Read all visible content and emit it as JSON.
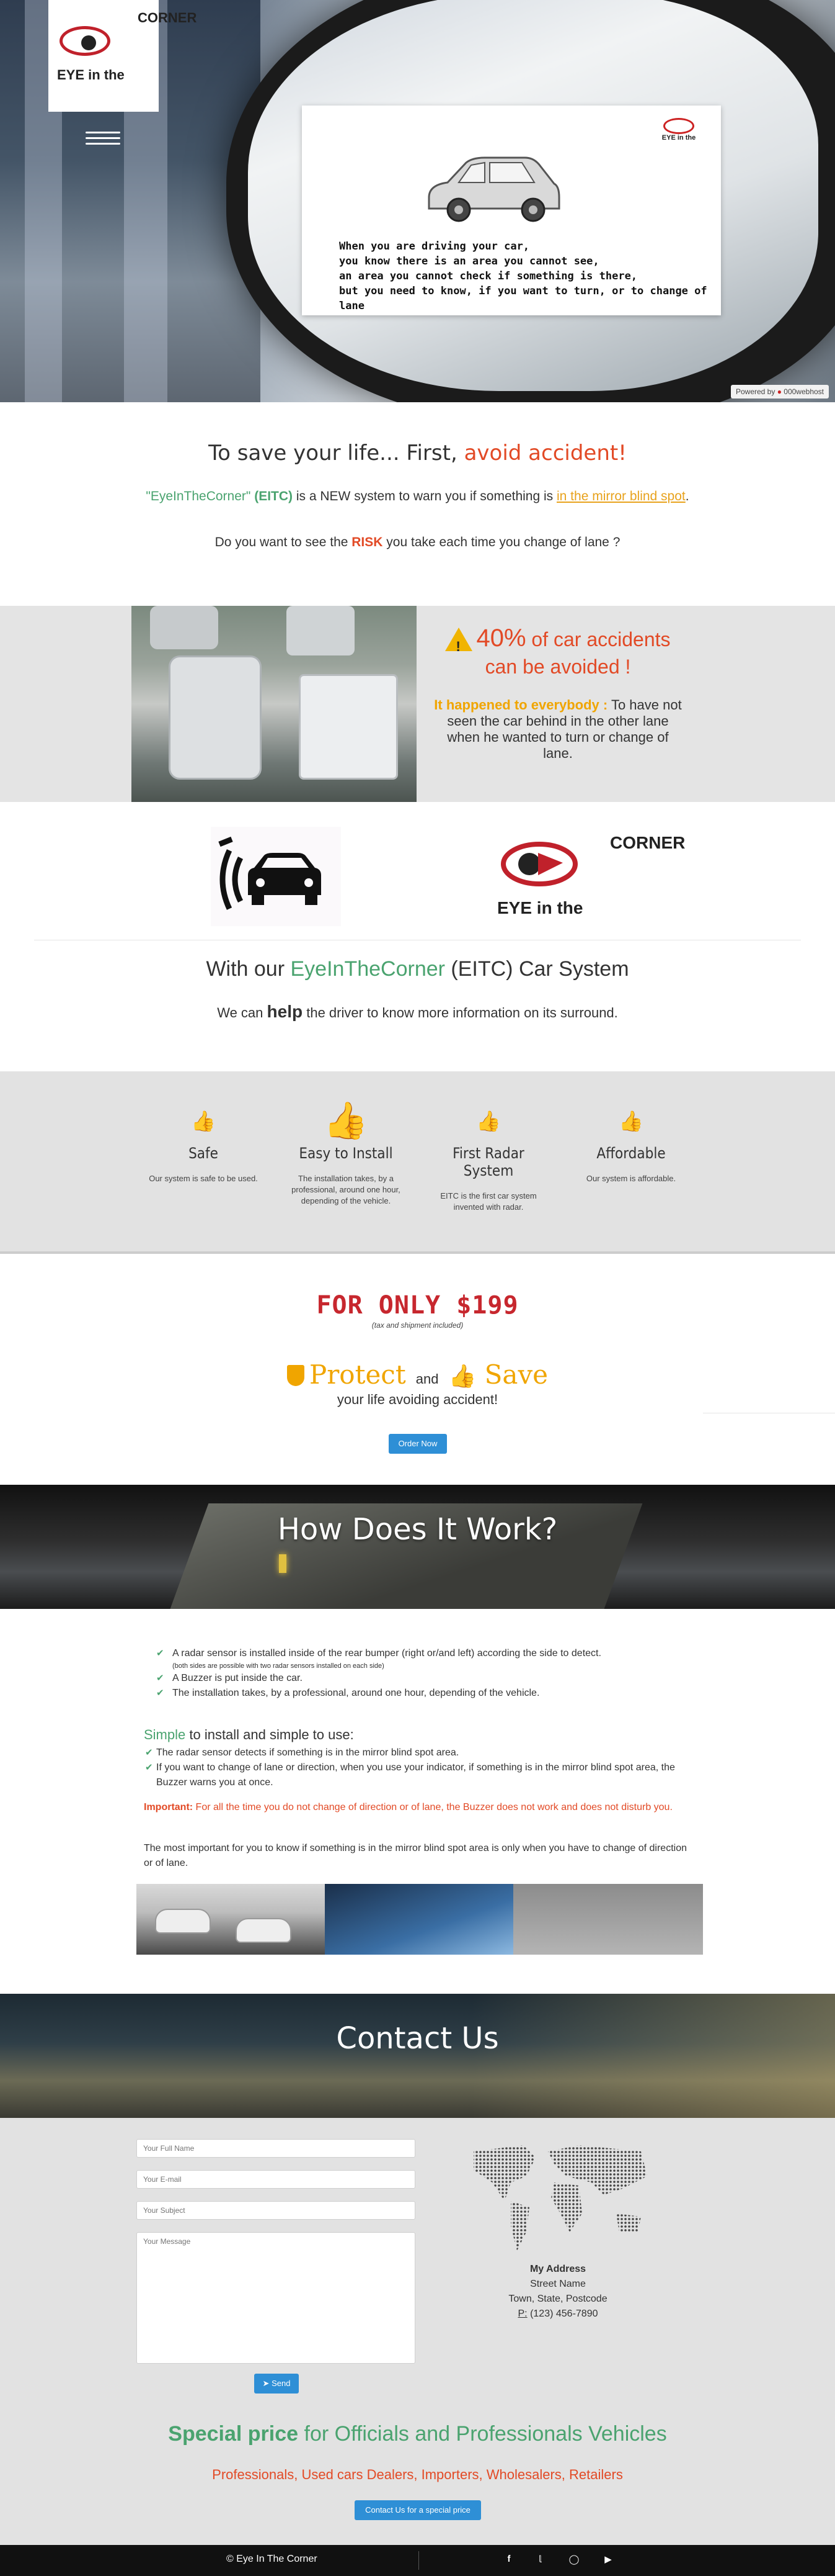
{
  "hero": {
    "logo": {
      "eye_text": "EYE in the",
      "corner_text": "CORNER"
    },
    "card_text": "When you are driving your car,\nyou know there is an area you cannot see,\nan area you cannot check if something is there,\nbut you need to know, if you want to turn, or to change of lane",
    "mini_logo_text": "EYE in the",
    "powered_label": "Powered by",
    "powered_brand": "000webhost"
  },
  "intro": {
    "title_start": "To save your life... First, ",
    "title_highlight": "avoid accident!",
    "p1_brand": "\"EyeInTheCorner\"",
    "p1_eitc": "(EITC)",
    "p1_mid": " is a NEW system to warn you if something is ",
    "p1_link": "in the mirror blind spot",
    "p1_end": ".",
    "p2_start": "Do you want to see the ",
    "p2_risk": "RISK",
    "p2_end": " you take each time you change of lane ?"
  },
  "stats": {
    "percent": "40%",
    "percent_rest": " of car accidents",
    "can_avoid": "can be avoided !",
    "happened": "It happened to everybody :",
    "body": " To have not seen the car behind in the other lane when he wanted to turn or change of lane.",
    "warning_icon": "warning-icon"
  },
  "system": {
    "logo_eye_text": "EYE in the",
    "logo_corner_text": "CORNER",
    "heading_start": "With our ",
    "heading_brand": "EyeInTheCorner",
    "heading_end": " (EITC) Car System",
    "p_start": "We can ",
    "p_help": "help",
    "p_end": " the driver to know more information on its surround."
  },
  "features": [
    {
      "title": "Safe",
      "desc": "Our system is safe to be used.",
      "icon": "thumbs-up-icon"
    },
    {
      "title": "Easy to Install",
      "desc": "The installation takes, by a professional, around one hour, depending of the vehicle.",
      "icon": "thumbs-up-icon"
    },
    {
      "title": "First Radar System",
      "desc": "EITC is the first car system invented with radar.",
      "icon": "thumbs-up-icon"
    },
    {
      "title": "Affordable",
      "desc": "Our system is affordable.",
      "icon": "thumbs-up-icon"
    }
  ],
  "price": {
    "only": "FOR ONLY $199",
    "tax": "(tax and shipment included)",
    "protect": "Protect",
    "and": "and",
    "save": "Save",
    "life": "your life avoiding accident!",
    "order_btn": "Order Now"
  },
  "how": {
    "banner": "How Does It Work?",
    "items": [
      "A radar sensor is installed inside of the rear bumper (right or/and left) according the side to detect.",
      "A Buzzer is put inside the car.",
      "The installation takes, by a professional, around one hour, depending of the vehicle."
    ],
    "note": "(both sides are possible with two radar sensors installed on each side)",
    "simple_green": "Simple",
    "simple_rest": " to install and simple to use:",
    "items2": [
      "The radar sensor detects if something is in the mirror blind spot area.",
      "If you want to change of lane or direction, when you use your indicator, if something is in the mirror blind spot area, the Buzzer warns you at once."
    ],
    "important_label": "Important:",
    "important_text": " For all the time you do not change of direction or of lane, the Buzzer does not work and does not disturb you.",
    "most": "The most important for you to know if something is in the mirror blind spot area is only when you have to change of direction or of lane."
  },
  "contact": {
    "banner": "Contact Us",
    "name_ph": "Your Full Name",
    "email_ph": "Your E-mail",
    "subject_ph": "Your Subject",
    "message_ph": "Your Message",
    "send_btn": "Send",
    "addr_title": "My Address",
    "street": "Street Name",
    "town": "Town, State, Postcode",
    "phone_label": "P:",
    "phone": " (123) 456-7890",
    "special_green": "Special price",
    "special_rest": " for Officials and Professionals Vehicles",
    "pros": "Professionals, Used cars Dealers, Importers, Wholesalers, Retailers",
    "contact_btn": "Contact Us for a special price"
  },
  "footer": {
    "copyright": "© Eye In The Corner",
    "social": [
      "facebook-icon",
      "twitter-icon",
      "instagram-icon",
      "youtube-icon"
    ]
  },
  "colors": {
    "green": "#4aa36f",
    "red": "#e24a26",
    "orange": "#f0a500",
    "blue": "#2e8fd6"
  }
}
